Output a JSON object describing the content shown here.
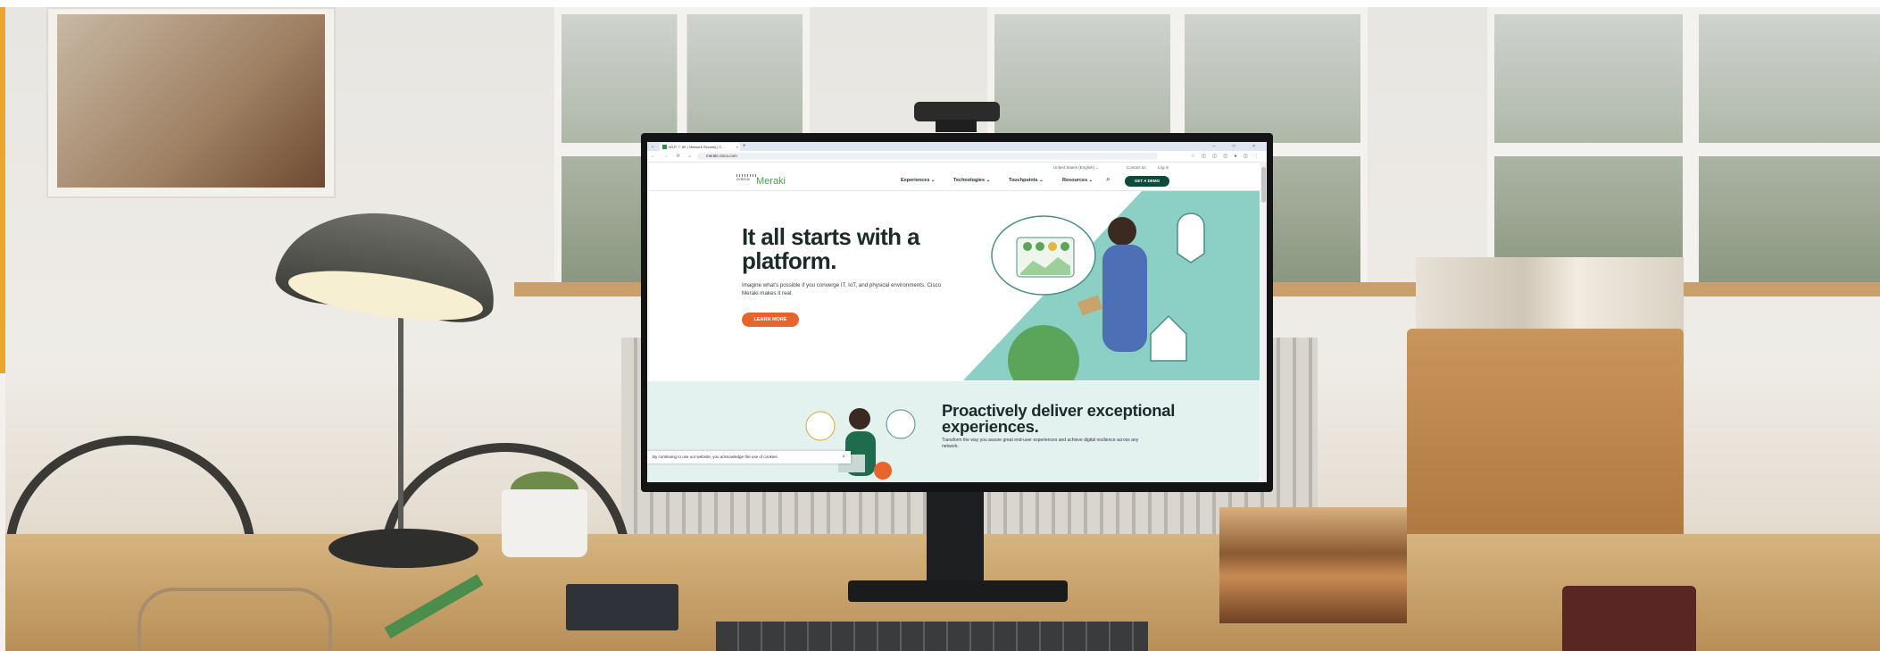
{
  "browser": {
    "tab_title": "Wi-Fi 7, 6E | Network Security | C...",
    "tab_close": "×",
    "new_tab": "+",
    "tab_menu": "⌄",
    "window_controls": "–  □  ×",
    "nav_buttons": "← → ⟳ ⌂",
    "url": "meraki.cisco.com",
    "extension_icons": "☆ ◫ ◫ ◫ ● ◫ ⋮"
  },
  "utility_nav": {
    "language": "United States (English) ⌄",
    "contact": "Contact us",
    "login": "Log in"
  },
  "main_nav": {
    "logo_cisco": "CISCO",
    "logo_meraki": "Meraki",
    "items": [
      {
        "label": "Experiences ⌄"
      },
      {
        "label": "Technologies ⌄"
      },
      {
        "label": "Touchpoints ⌄"
      },
      {
        "label": "Resources ⌄"
      }
    ],
    "search_icon": "⌕",
    "cta": "GET A DEMO"
  },
  "hero": {
    "title": "It all starts with a platform.",
    "text": "Imagine what's possible if you converge IT, IoT, and physical environments. Cisco Meraki makes it real.",
    "button": "LEARN MORE"
  },
  "section2": {
    "title": "Proactively deliver exceptional experiences.",
    "text": "Transform the way you assure great end-user experiences and achieve digital resilience across any network."
  },
  "cookie_banner": {
    "text": "By continuing to use our website, you acknowledge the use of cookies.",
    "close": "×"
  },
  "colors": {
    "brand_green": "#4f9a53",
    "cta_dark": "#0d4a3c",
    "learn_orange": "#e8642c",
    "hero_teal": "#8ccfc5",
    "section_bg": "#e3f1ef"
  }
}
